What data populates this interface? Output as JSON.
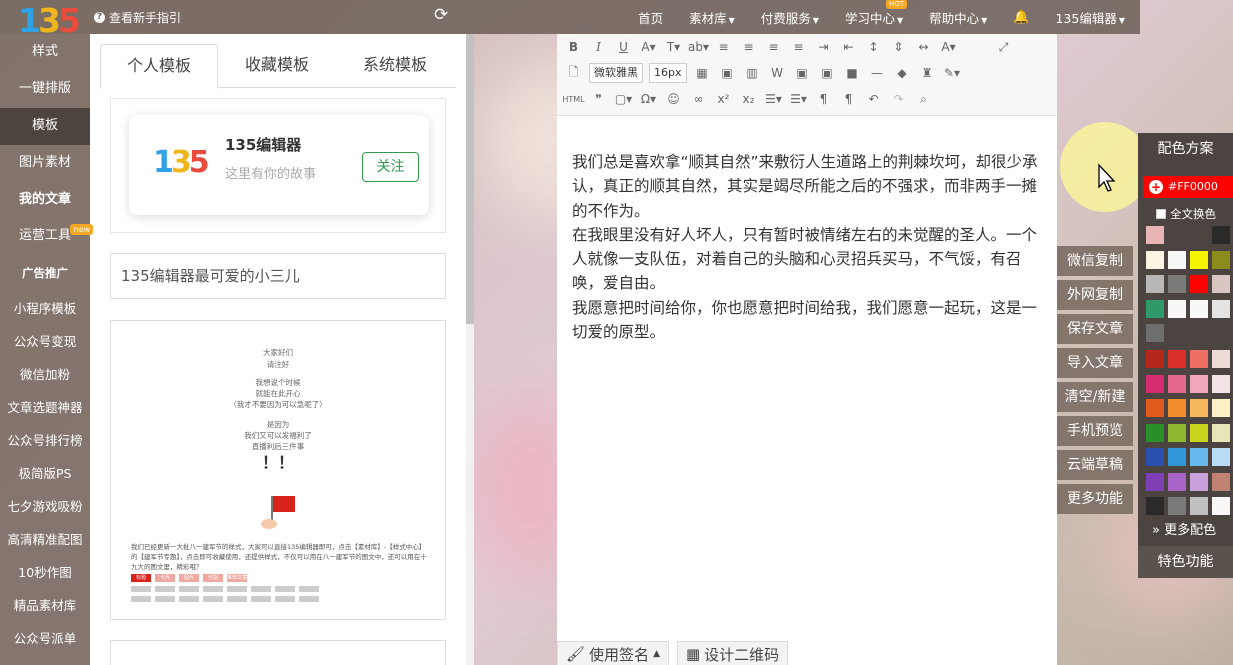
{
  "topbar": {
    "logo": "135",
    "guide": "查看新手指引",
    "nav": [
      {
        "label": "首页",
        "caret": false,
        "hot": false
      },
      {
        "label": "素材库",
        "caret": true,
        "hot": false
      },
      {
        "label": "付费服务",
        "caret": true,
        "hot": false
      },
      {
        "label": "学习中心",
        "caret": true,
        "hot": true
      },
      {
        "label": "帮助中心",
        "caret": true,
        "hot": false
      },
      {
        "label": "135编辑器",
        "caret": true,
        "hot": false
      }
    ],
    "hot_label": "HOT"
  },
  "sidebar": {
    "items": [
      {
        "label": "样式"
      },
      {
        "label": "一键排版"
      },
      {
        "label": "模板"
      },
      {
        "label": "图片素材"
      },
      {
        "label": "我的文章"
      },
      {
        "label": "运营工具"
      }
    ],
    "new_badge": "new",
    "ad_label": "广告推广",
    "sub_items": [
      "小程序模板",
      "公众号变现",
      "微信加粉",
      "文章选题神器",
      "公众号排行榜",
      "极简版PS",
      "七夕游戏吸粉",
      "高清精准配图",
      "10秒作图",
      "精品素材库",
      "公众号派单"
    ]
  },
  "templates": {
    "tabs": [
      "个人模板",
      "收藏模板",
      "系统模板"
    ],
    "card": {
      "logo": "135",
      "name": "135编辑器",
      "desc": "这里有你的故事",
      "follow": "关注"
    },
    "search_value": "135编辑器最可爱的小三儿",
    "preview": {
      "lines": [
        "大家好们",
        "请注好",
        "我想说个时候",
        "就能在此开心",
        "（我才不要因为可以急呢了）",
        "是因为",
        "我们又可以发福利了",
        "直播利后三件事"
      ],
      "exclaim": "！！",
      "para": "我们已经更新一大批八一建军节的样式，大家可以直接135编辑器即可，点击【素材库】-【样式中心】的【建军节专题】，点击即可收藏使用，还提供样式，不仅可以用在八一建军节的图文中，还可以用在十九大的图文里，精彩哦？"
    },
    "preview_tabs": [
      "标题",
      "卡片",
      "图片",
      "分割",
      "推荐文章"
    ]
  },
  "editor": {
    "font_family": "微软雅黑",
    "font_size": "16px",
    "content": [
      "我们总是喜欢拿“顺其自然”来敷衍人生道路上的荆棘坎坷，却很少承认，真正的顺其自然，其实是竭尽所能之后的不强求，而非两手一摊的不作为。",
      "在我眼里没有好人坏人，只有暂时被情绪左右的未觉醒的圣人。一个人就像一支队伍，对着自己的头脑和心灵招兵买马，不气馁，有召唤，爱自由。",
      "我愿意把时间给你，你也愿意把时间给我，我们愿意一起玩，这是一切爱的原型。"
    ],
    "footer": {
      "sign": "使用签名",
      "qrcode": "设计二维码"
    }
  },
  "actions": [
    "微信复制",
    "外网复制",
    "保存文章",
    "导入文章",
    "清空/新建",
    "手机预览",
    "云端草稿",
    "更多功能"
  ],
  "colors": {
    "title": "配色方案",
    "current": "#FF0000",
    "full_change": "全文换色",
    "more": "更多配色",
    "special": "特色功能",
    "swatches": [
      "#e8b4b4",
      "#4b4440",
      "#4b4440",
      "#2a2a2a",
      "#fdf5e4",
      "#f8f8f8",
      "#f5f500",
      "#8c8c1c",
      "#b8b8b8",
      "#7a7a7a",
      "#ff0000",
      "#d9c6c0",
      "#2e9a6a",
      "#f8f8f8",
      "#f8f8f8",
      "#e4e4e4",
      "#6e6e6e",
      "#4b4440",
      "#4b4440",
      "#4b4440",
      "#b5271c",
      "#d9302a",
      "#ee7065",
      "#efdbd5",
      "#d62d70",
      "#e5698f",
      "#f0a6bd",
      "#f3e3e8",
      "#e05a1b",
      "#f18e2b",
      "#f6b85a",
      "#fdf0c8",
      "#2a8f2a",
      "#8db82f",
      "#c7d51d",
      "#e6e6b8",
      "#2a4fae",
      "#2f97d8",
      "#69b9ec",
      "#b9dcf5",
      "#7f3fb5",
      "#a864c8",
      "#c9a1dc",
      "#c08272",
      "#2a2a2a",
      "#7a7a7a",
      "#c0c0c0",
      "#f8f8f8"
    ]
  }
}
